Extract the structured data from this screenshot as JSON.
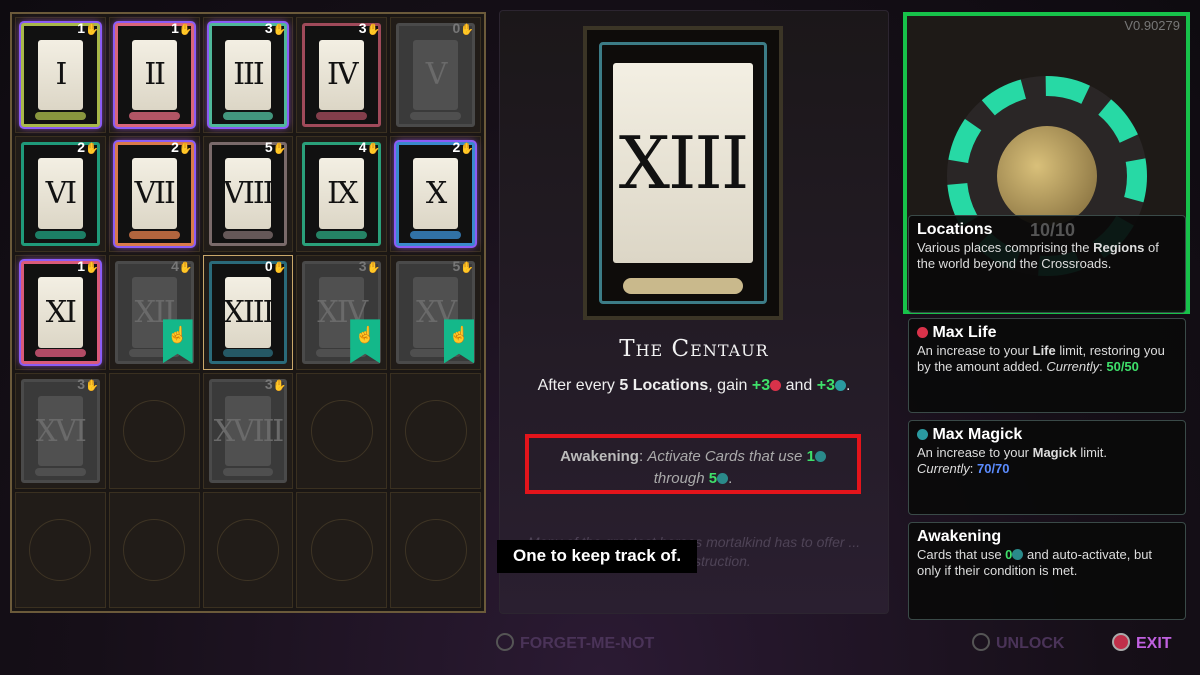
{
  "cards": [
    {
      "numeral": "I",
      "cost": "1",
      "state": "highlighted",
      "accent": "#a8b84a"
    },
    {
      "numeral": "II",
      "cost": "1",
      "state": "highlighted",
      "accent": "#d9667a"
    },
    {
      "numeral": "III",
      "cost": "3",
      "state": "highlighted",
      "accent": "#4fb89a"
    },
    {
      "numeral": "IV",
      "cost": "3",
      "state": "normal",
      "accent": "#a04a5a"
    },
    {
      "numeral": "V",
      "cost": "0",
      "state": "locked",
      "accent": "#555555"
    },
    {
      "numeral": "VI",
      "cost": "2",
      "state": "normal",
      "accent": "#1f9a7a"
    },
    {
      "numeral": "VII",
      "cost": "2",
      "state": "highlighted",
      "accent": "#d97a4a"
    },
    {
      "numeral": "VIII",
      "cost": "5",
      "state": "normal",
      "accent": "#7a6a6a"
    },
    {
      "numeral": "IX",
      "cost": "4",
      "state": "normal",
      "accent": "#2aa07a"
    },
    {
      "numeral": "X",
      "cost": "2",
      "state": "highlighted",
      "accent": "#3a8acc"
    },
    {
      "numeral": "XI",
      "cost": "1",
      "state": "highlighted",
      "accent": "#d95a7a"
    },
    {
      "numeral": "XII",
      "cost": "4",
      "state": "locked",
      "flag": true,
      "accent": "#555555"
    },
    {
      "numeral": "XIII",
      "cost": "0",
      "state": "selected",
      "accent": "#2a6a7a"
    },
    {
      "numeral": "XIV",
      "cost": "3",
      "state": "locked",
      "flag": true,
      "accent": "#555555"
    },
    {
      "numeral": "XV",
      "cost": "5",
      "state": "locked",
      "flag": true,
      "accent": "#555555"
    },
    {
      "numeral": "XVI",
      "cost": "3",
      "state": "locked",
      "accent": "#555555"
    },
    {
      "state": "empty"
    },
    {
      "numeral": "XVIII",
      "cost": "3",
      "state": "locked",
      "accent": "#555555"
    },
    {
      "state": "empty"
    },
    {
      "state": "empty"
    },
    {
      "state": "empty"
    },
    {
      "state": "empty"
    },
    {
      "state": "empty"
    },
    {
      "state": "empty"
    },
    {
      "state": "empty"
    }
  ],
  "selected": {
    "numeral": "XIII",
    "title": "The Centaur",
    "effect": {
      "pre": "After every ",
      "bold": "5 Locations",
      "mid": ", gain ",
      "v1": "+3",
      "and": " and ",
      "v2": "+3",
      "end": "."
    },
    "awakening": {
      "label": "Awakening",
      "colon": ": ",
      "text": "Activate Cards that use ",
      "n1": "1",
      "through": " through ",
      "n2": "5",
      "end": "."
    },
    "flavor": "Many of the greatest heroes mortalkind has to offer ... patient instruction."
  },
  "caption": "One to keep track of.",
  "version": "V0.90279",
  "portrait": {
    "count": "10/10"
  },
  "info": [
    {
      "title": "Locations",
      "pre": "Various places comprising the ",
      "bold": "Regions",
      "post": " of the world beyond the Crossroads."
    },
    {
      "title": "Max Life",
      "pre": "An increase to your ",
      "bold": "Life",
      "post": " limit, restoring you by the amount added. ",
      "cur_label": "Currently",
      "cur": "50/50"
    },
    {
      "title": "Max Magick",
      "pre": "An increase to your ",
      "bold": "Magick",
      "post": " limit. ",
      "cur_label": "Currently",
      "cur": "70/70"
    },
    {
      "title": "Awakening",
      "pre": "Cards that use ",
      "bold": "0",
      "post": " and auto-activate, but only if their condition is met."
    }
  ],
  "buttons": {
    "forget": "FORGET-ME-NOT",
    "unlock": "UNLOCK",
    "exit": "EXIT"
  },
  "colors": {
    "green": "#3ee06a",
    "magick": "#5b8cff",
    "highlight": "#a855f7",
    "awakening_box": "#e3141b",
    "exit": "#c060e0"
  }
}
